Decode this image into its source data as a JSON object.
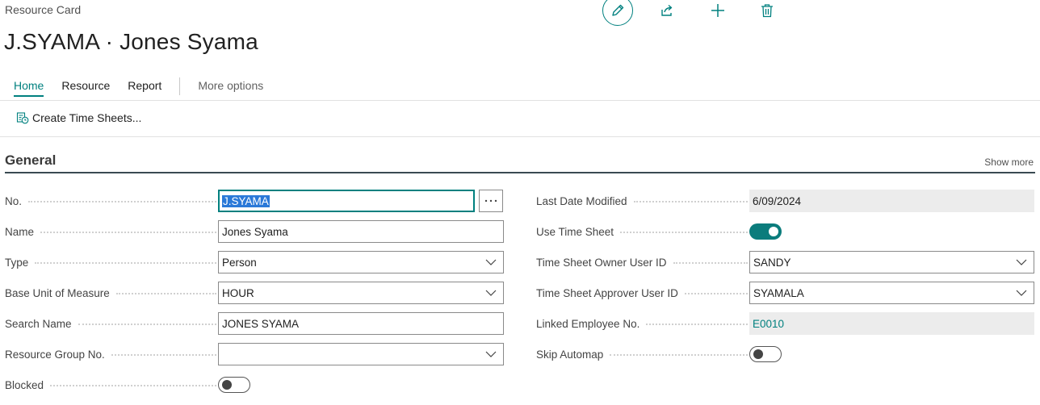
{
  "page": {
    "caption": "Resource Card",
    "title": "J.SYAMA · Jones Syama"
  },
  "header_actions": [
    {
      "name": "edit",
      "icon": "pencil-icon"
    },
    {
      "name": "share",
      "icon": "share-icon"
    },
    {
      "name": "new",
      "icon": "plus-icon"
    },
    {
      "name": "delete",
      "icon": "trash-icon"
    }
  ],
  "tabs": {
    "home": "Home",
    "resource": "Resource",
    "report": "Report",
    "more": "More options"
  },
  "actions": {
    "create_time_sheets": "Create Time Sheets..."
  },
  "section": {
    "title": "General",
    "show_more": "Show more"
  },
  "left_fields": {
    "no": {
      "label": "No.",
      "value": "J.SYAMA"
    },
    "name": {
      "label": "Name",
      "value": "Jones Syama"
    },
    "type": {
      "label": "Type",
      "value": "Person"
    },
    "base_unit": {
      "label": "Base Unit of Measure",
      "value": "HOUR"
    },
    "search_name": {
      "label": "Search Name",
      "value": "JONES SYAMA"
    },
    "resource_group": {
      "label": "Resource Group No.",
      "value": ""
    },
    "blocked": {
      "label": "Blocked",
      "value": false
    }
  },
  "right_fields": {
    "last_modified": {
      "label": "Last Date Modified",
      "value": "6/09/2024"
    },
    "use_time_sheet": {
      "label": "Use Time Sheet",
      "value": true
    },
    "owner_user": {
      "label": "Time Sheet Owner User ID",
      "value": "SANDY"
    },
    "approver_user": {
      "label": "Time Sheet Approver User ID",
      "value": "SYAMALA"
    },
    "linked_employee": {
      "label": "Linked Employee No.",
      "value": "E0010"
    },
    "skip_automap": {
      "label": "Skip Automap",
      "value": false
    }
  },
  "colors": {
    "accent": "#00807f",
    "toggle_on": "#0b7c7c",
    "selection": "#2b79d8"
  }
}
